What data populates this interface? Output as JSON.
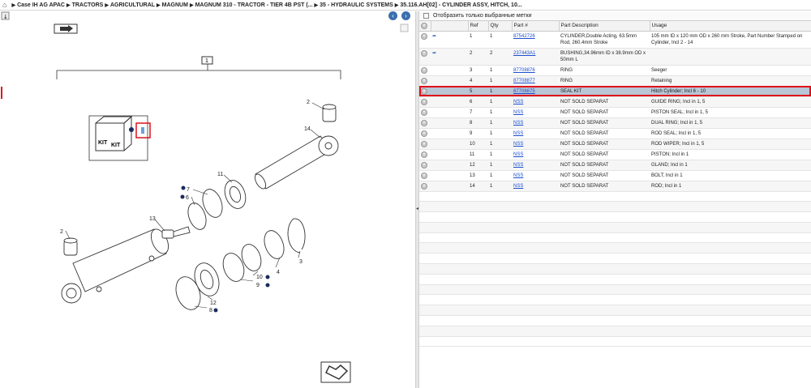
{
  "breadcrumb": [
    "Case IH AG APAC",
    "TRACTORS",
    "AGRICULTURAL",
    "MAGNUM",
    "MAGNUM 310 - TRACTOR - TIER 4B PST (...",
    "35 - HYDRAULIC SYSTEMS",
    "35.116.AH[02] - CYLINDER ASSY, HITCH, 10..."
  ],
  "filter_label": "Отобразить только выбранные метки",
  "columns": [
    "Ref",
    "Qty",
    "Part #",
    "Part Description",
    "Usage"
  ],
  "rows": [
    {
      "ref": "1",
      "qty": "1",
      "part": "87542726",
      "desc": "CYLINDER,Double Acting, 63.5mm Rod, 260.4mm Stroke",
      "usage": "105 mm ID x 120 mm OD x 260 mm Stroke, Part Number Stamped on Cylinder, Incl 2 - 14",
      "icon": true
    },
    {
      "ref": "2",
      "qty": "2",
      "part": "237443A1",
      "desc": "BUSHING,34.96mm ID x 38.9mm OD x 50mm L",
      "usage": "",
      "icon": true
    },
    {
      "ref": "3",
      "qty": "1",
      "part": "87708876",
      "desc": "RING",
      "usage": "Seeger"
    },
    {
      "ref": "4",
      "qty": "1",
      "part": "87708877",
      "desc": "RING",
      "usage": "Retaining"
    },
    {
      "ref": "5",
      "qty": "1",
      "part": "87708875",
      "desc": "SEAL KIT",
      "usage": "Hitch Cylinder;  Incl 6 - 10"
    },
    {
      "ref": "6",
      "qty": "1",
      "part": "NSS",
      "desc": "NOT SOLD SEPARAT",
      "usage": "GUIDE RING;  Incl in 1, 5"
    },
    {
      "ref": "7",
      "qty": "1",
      "part": "NSS",
      "desc": "NOT SOLD SEPARAT",
      "usage": "PISTON SEAL;  Incl in 1, 5"
    },
    {
      "ref": "8",
      "qty": "1",
      "part": "NSS",
      "desc": "NOT SOLD SEPARAT",
      "usage": "DUAL RING;  Incl in 1, 5"
    },
    {
      "ref": "9",
      "qty": "1",
      "part": "NSS",
      "desc": "NOT SOLD SEPARAT",
      "usage": "ROD SEAL;  Incl in 1, 5"
    },
    {
      "ref": "10",
      "qty": "1",
      "part": "NSS",
      "desc": "NOT SOLD SEPARAT",
      "usage": "ROD WIPER;  Incl in 1, 5"
    },
    {
      "ref": "11",
      "qty": "1",
      "part": "NSS",
      "desc": "NOT SOLD SEPARAT",
      "usage": "PISTON;  Incl in 1"
    },
    {
      "ref": "12",
      "qty": "1",
      "part": "NSS",
      "desc": "NOT SOLD SEPARAT",
      "usage": "GLAND;  Incl in 1"
    },
    {
      "ref": "13",
      "qty": "1",
      "part": "NSS",
      "desc": "NOT SOLD SEPARAT",
      "usage": "BOLT;  Incl in 1"
    },
    {
      "ref": "14",
      "qty": "1",
      "part": "NSS",
      "desc": "NOT SOLD SEPARAT",
      "usage": "ROD;  Incl in 1"
    }
  ],
  "selected_ref": "5",
  "diagram_labels": {
    "l1": "1",
    "l2a": "2",
    "l2b": "2",
    "l14": "14",
    "l11": "11",
    "l7": "7",
    "l6": "6",
    "l13": "13",
    "l3": "3",
    "l4": "4",
    "l5": "5",
    "l10": "10",
    "l9": "9",
    "l12": "12",
    "l8": "8",
    "kit1": "KIT",
    "kit2": "KIT"
  },
  "colors": {
    "selected_row": "#b9c6d6",
    "highlight": "#e0101a",
    "link": "#1a4fcf"
  }
}
